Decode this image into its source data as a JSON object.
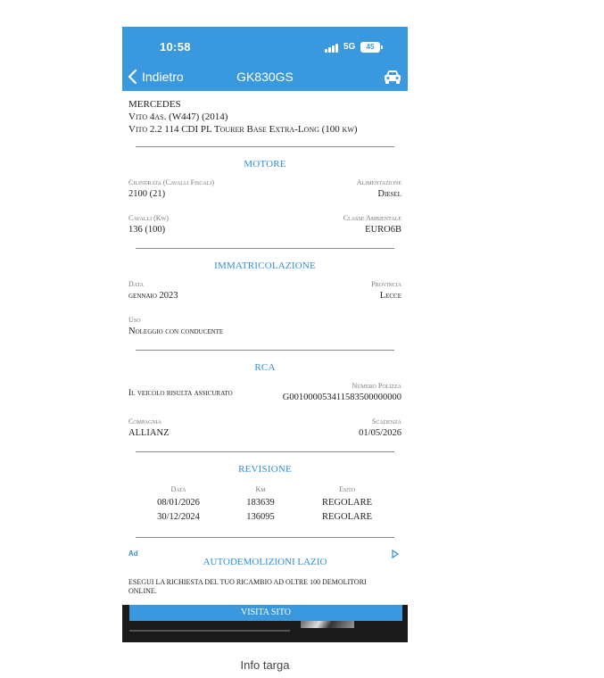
{
  "status_bar": {
    "time": "10:58",
    "network": "5G",
    "battery": "45"
  },
  "nav": {
    "back_label": "Indietro",
    "title": "GK830GS"
  },
  "vehicle": {
    "make": "MERCEDES",
    "model": "Vito 4as. (W447) (2014)",
    "version": "Vito 2.2 114 CDI PL Tourer Base Extra-Long (100 kw)"
  },
  "motore": {
    "title": "MOTORE",
    "cilindrata_label": "Cilindrata (Cavalli Fiscali)",
    "cilindrata_value": "2100 (21)",
    "alimentazione_label": "Alimentazione",
    "alimentazione_value": "Diesel",
    "cavalli_label": "Cavalli (Kw)",
    "cavalli_value": "136 (100)",
    "classe_label": "Classe Ambientale",
    "classe_value": "EURO6B"
  },
  "immatricolazione": {
    "title": "IMMATRICOLAZIONE",
    "data_label": "Data",
    "data_value": "gennaio 2023",
    "provincia_label": "Provincia",
    "provincia_value": "Lecce",
    "uso_label": "Uso",
    "uso_value": "Noleggio con conducente"
  },
  "rca": {
    "title": "RCA",
    "status": "Il veicolo risulta assicurato",
    "polizza_label": "Numero Polizza",
    "polizza_value": "G001000053411583500000000",
    "compagnia_label": "Compagnia",
    "compagnia_value": "ALLIANZ",
    "scadenza_label": "Scadenza",
    "scadenza_value": "01/05/2026"
  },
  "revisione": {
    "title": "REVISIONE",
    "headers": [
      "Data",
      "Km",
      "Esito"
    ],
    "rows": [
      [
        "08/01/2026",
        "183639",
        "REGOLARE"
      ],
      [
        "30/12/2024",
        "136095",
        "REGOLARE"
      ]
    ]
  },
  "ad": {
    "badge": "Ad",
    "title": "AUTODEMOLIZIONI LAZIO",
    "text": "ESEGUI LA RICHIESTA DEL TUO RICAMBIO AD OLTRE 100 DEMOLITORI ONLINE.",
    "button": "VISITA SITO"
  },
  "caption": "Info targa",
  "colors": {
    "accent": "#3a98df",
    "section_title": "#2f8fd6"
  },
  "icons": {
    "back": "chevron-left-icon",
    "car": "car-icon",
    "ad_choices": "ad-choices-icon"
  }
}
